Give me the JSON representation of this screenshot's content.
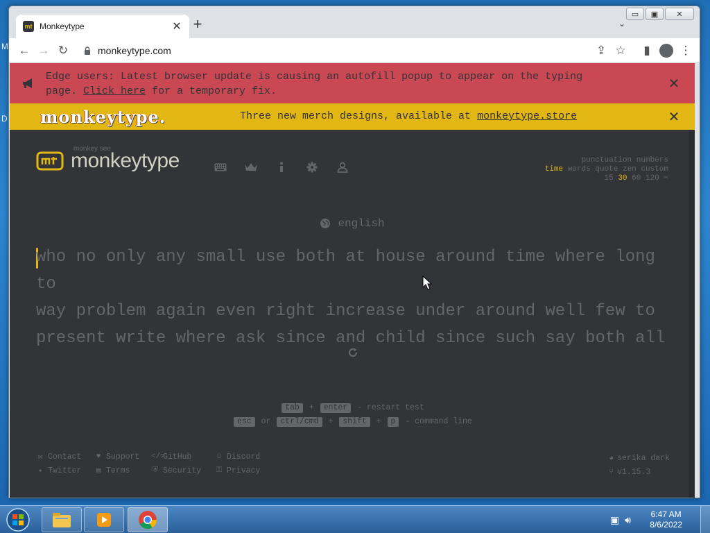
{
  "desktop": {
    "edge_letter_top": "M",
    "edge_letter_mid": "D"
  },
  "browser": {
    "tab_title": "Monkeytype",
    "favicon_text": "mt",
    "new_tab_label": "+",
    "url": "monkeytype.com"
  },
  "banners": {
    "red": {
      "line1": "Edge users: Latest browser update is causing an autofill popup to appear on the typing",
      "line2_prefix": "page. ",
      "link": "Click here",
      "line2_suffix": " for a temporary fix."
    },
    "yellow": {
      "logo_text": "monkeytype.",
      "text_prefix": "Three new merch designs, available at ",
      "link": "monkeytype.store"
    }
  },
  "header": {
    "brand_small": "monkey see",
    "brand": "monkeytype",
    "nav_icons": [
      "keyboard-icon",
      "crown-icon",
      "info-icon",
      "gear-icon",
      "user-icon"
    ]
  },
  "config": {
    "row1": [
      "punctuation",
      "numbers"
    ],
    "row2": [
      "time",
      "words",
      "quote",
      "zen",
      "custom"
    ],
    "row2_active": "time",
    "row3": [
      "15",
      "30",
      "60",
      "120"
    ],
    "row3_active": "30"
  },
  "test": {
    "language": "english",
    "lines": [
      "who no only any small use both at house around time where long to",
      "way problem again even right increase under around well few to",
      "present write where ask since and child since such say both all"
    ]
  },
  "hints": {
    "line1": {
      "key1": "tab",
      "plus": "+",
      "key2": "enter",
      "text": "- restart test"
    },
    "line2": {
      "key1": "esc",
      "or": "or",
      "key2": "ctrl/cmd",
      "plus": "+",
      "key3": "shift",
      "plus2": "+",
      "key4": "p",
      "text": "- command line"
    }
  },
  "footer": {
    "links": [
      "Contact",
      "Support",
      "GitHub",
      "Discord",
      "Twitter",
      "Terms",
      "Security",
      "Privacy"
    ],
    "theme": "serika dark",
    "version": "v1.15.3"
  },
  "taskbar": {
    "time": "6:47 AM",
    "date": "8/6/2022"
  },
  "colors": {
    "bg": "#323437",
    "main": "#e2b714",
    "sub": "#646669",
    "text": "#d1d0c5",
    "error": "#ca4754"
  }
}
